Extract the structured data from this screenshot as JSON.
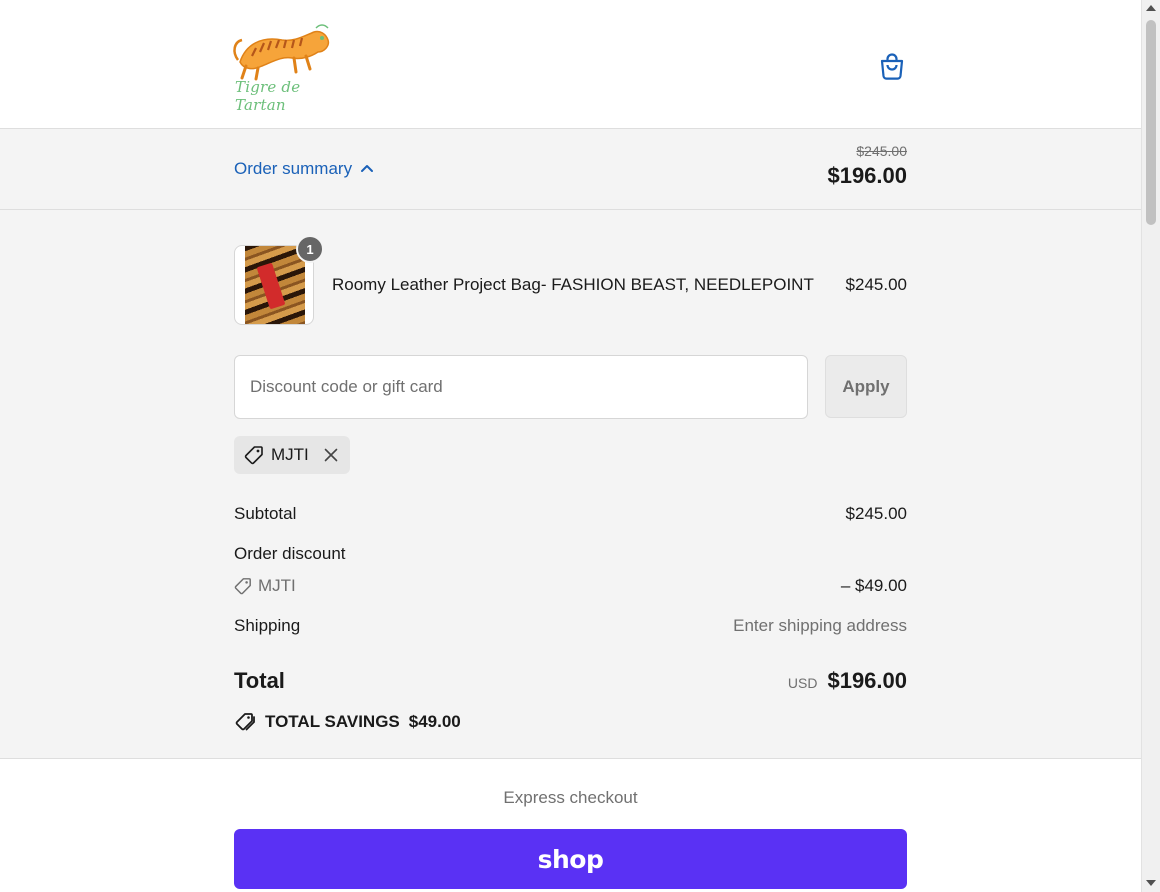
{
  "header": {
    "logo_text": "Tigre de Tartan",
    "cart_icon": "shopping-bag-icon"
  },
  "summary": {
    "toggle_label": "Order summary",
    "toggle_icon": "chevron-up-icon",
    "original_price": "$245.00",
    "current_price": "$196.00"
  },
  "cart": {
    "items": [
      {
        "name": "Roomy Leather Project Bag- FASHION BEAST, NEEDLEPOINT",
        "price": "$245.00",
        "quantity": "1"
      }
    ]
  },
  "discount": {
    "placeholder": "Discount code or gift card",
    "apply_label": "Apply",
    "applied_code": "MJTI"
  },
  "totals": {
    "subtotal_label": "Subtotal",
    "subtotal_value": "$245.00",
    "order_discount_label": "Order discount",
    "discount_code": "MJTI",
    "discount_value": "– $49.00",
    "shipping_label": "Shipping",
    "shipping_value": "Enter shipping address",
    "total_label": "Total",
    "currency": "USD",
    "total_value": "$196.00",
    "savings_label": "TOTAL SAVINGS",
    "savings_value": "$49.00"
  },
  "express": {
    "label": "Express checkout",
    "shop_pay_label": "shop"
  },
  "colors": {
    "link_blue": "#1a61b8",
    "shop_purple": "#5a31f4",
    "panel_gray": "#f4f4f4"
  }
}
